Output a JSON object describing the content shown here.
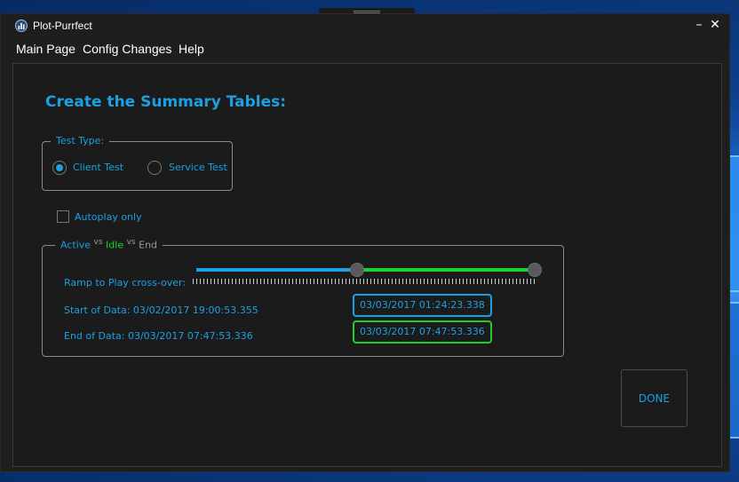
{
  "window": {
    "title": "Plot-Purrfect",
    "minimize": "–",
    "close": "✕"
  },
  "menu": [
    "Main Page",
    "Config Changes",
    "Help"
  ],
  "heading": "Create the Summary Tables:",
  "test_type": {
    "legend": "Test Type:",
    "options": [
      {
        "label": "Client Test",
        "checked": true
      },
      {
        "label": "Service Test",
        "checked": false
      }
    ]
  },
  "autoplay": {
    "label": "Autoplay only",
    "checked": false
  },
  "range_group": {
    "legend": {
      "active": "Active",
      "vs1": "vs",
      "idle": "Idle",
      "vs2": "vs",
      "end": "End"
    },
    "slider_label": "Ramp to Play cross-over:",
    "start_of_data": "Start of Data: 03/02/2017 19:00:53.355",
    "end_of_data": "End of Data: 03/03/2017 07:47:53.336",
    "crossover_time": "03/03/2017 01:24:23.338",
    "end_time": "03/03/2017 07:47:53.336"
  },
  "done_button": "DONE",
  "colors": {
    "accent": "#1ba1e2",
    "green": "#1ed12a",
    "background": "#1e1e1e"
  }
}
